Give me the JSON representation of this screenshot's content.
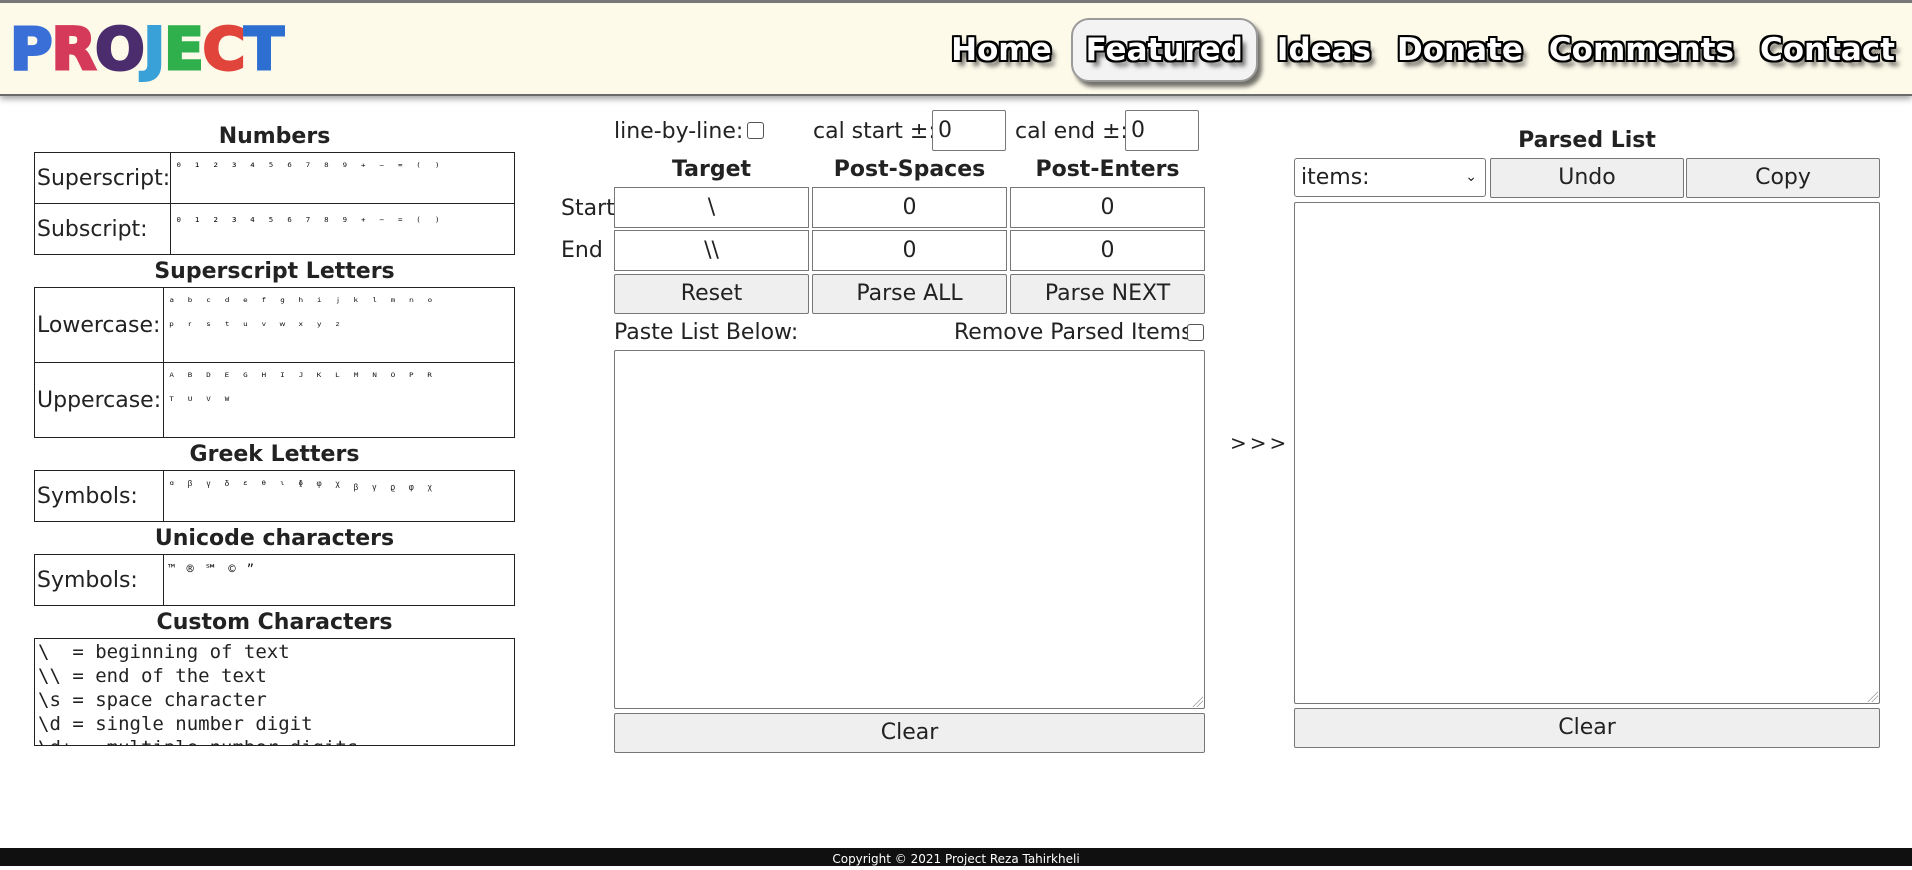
{
  "header": {
    "logo_letters": [
      {
        "ch": "P",
        "color": "#3a6fd8"
      },
      {
        "ch": "R",
        "color": "#d63a5a"
      },
      {
        "ch": "O",
        "color": "#4b2d6e"
      },
      {
        "ch": "J",
        "color": "#3aa0d8"
      },
      {
        "ch": "E",
        "color": "#2fb04c"
      },
      {
        "ch": "C",
        "color": "#e0443a"
      },
      {
        "ch": "T",
        "color": "#2d6fd0"
      }
    ],
    "nav": [
      "Home",
      "Featured",
      "Ideas",
      "Donate",
      "Comments",
      "Contact"
    ],
    "active_nav": "Featured"
  },
  "charpanel": {
    "numbers_title": "Numbers",
    "superscript_label": "Superscript:",
    "superscript_chars": "⁰ ¹ ² ³ ⁴ ⁵ ⁶ ⁷ ⁸ ⁹ ⁺ ⁻ ⁼ ⁽ ⁾",
    "subscript_label": "Subscript:",
    "subscript_chars": "₀ ₁ ₂ ₃ ₄ ₅ ₆ ₇ ₈ ₉ ₊ ₋ ₌ ₍ ₎",
    "sup_letters_title": "Superscript Letters",
    "lowercase_label": "Lowercase:",
    "lowercase_chars_1": "ᵃ ᵇ ᶜ ᵈ ᵉ ᶠ ᵍ ʰ ⁱ ʲ ᵏ ˡ ᵐ ⁿ ᵒ",
    "lowercase_chars_2": "ᵖ ʳ ˢ ᵗ ᵘ ᵛ ʷ ˣ ʸ ᶻ",
    "uppercase_label": "Uppercase:",
    "uppercase_chars_1": "ᴬ ᴮ ᴰ ᴱ ᴳ ᴴ ᴵ ᴶ ᴷ ᴸ ᴹ ᴺ ᴼ ᴾ ᴿ",
    "uppercase_chars_2": "ᵀ ᵁ ⱽ ᵂ",
    "greek_title": "Greek Letters",
    "greek_label": "Symbols:",
    "greek_chars": "ᵅ ᵝ ᵞ ᵟ ᵋ ᶿ ᶥ ᶲ ᵠ ᵡ ᵦ ᵧ ᵨ ᵩ ᵪ",
    "unicode_title": "Unicode characters",
    "unicode_label": "Symbols:",
    "unicode_chars": "™ ® ℠ © ”",
    "custom_title": "Custom Characters",
    "custom_lines": [
      "\\  = beginning of text",
      "\\\\ = end of the text",
      "\\s = space character",
      "\\d = single number digit",
      "\\d+ = multiple number digits"
    ]
  },
  "parser": {
    "line_by_line_label": "line-by-line:",
    "cal_start_label": "cal start ±:",
    "cal_start_value": "0",
    "cal_end_label": "cal end ±:",
    "cal_end_value": "0",
    "col_target": "Target",
    "col_post_spaces": "Post-Spaces",
    "col_post_enters": "Post-Enters",
    "start_label": "Start",
    "end_label": "End",
    "start_target": "\\",
    "start_spaces": "0",
    "start_enters": "0",
    "end_target": "\\\\",
    "end_spaces": "0",
    "end_enters": "0",
    "reset_label": "Reset",
    "parse_all_label": "Parse ALL",
    "parse_next_label": "Parse NEXT",
    "paste_label": "Paste List Below:",
    "remove_parsed_label": "Remove Parsed Items",
    "clear_label": "Clear"
  },
  "arrow": ">>>",
  "parsed": {
    "title": "Parsed List",
    "select_value": "items:",
    "undo_label": "Undo",
    "copy_label": "Copy",
    "clear_label": "Clear"
  },
  "footer": {
    "text": "Copyright © 2021 Project Reza Tahirkheli"
  }
}
